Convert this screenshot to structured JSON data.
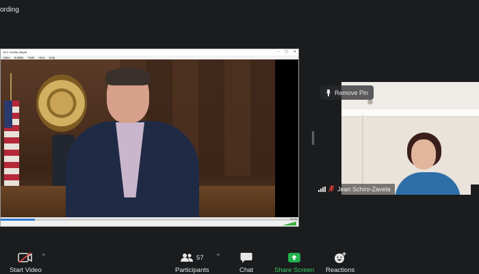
{
  "status": {
    "recording_label": "ording"
  },
  "shared_window": {
    "title": "VLC media player",
    "menu": [
      "Video",
      "Subtitle",
      "Tools",
      "View",
      "Help"
    ],
    "time": "25:26",
    "window_controls": [
      "–",
      "▢",
      "✕"
    ]
  },
  "pinned": {
    "remove_pin_label": "Remove Pin",
    "participant_name": "Jean Schiro-Zavela"
  },
  "toolbar": {
    "start_video": "Start Video",
    "participants": "Participants",
    "participants_count": "57",
    "chat": "Chat",
    "share_screen": "Share Screen",
    "reactions": "Reactions",
    "caret": "^"
  },
  "colors": {
    "background": "#1a1c1e",
    "share_green": "#22b14c",
    "muted_red": "#e0413a"
  },
  "icons": {
    "video": "video-off-icon",
    "participants": "participants-icon",
    "chat": "chat-bubble-icon",
    "share": "share-screen-icon",
    "reactions": "reactions-icon",
    "pin": "pin-icon",
    "mic": "mic-muted-icon",
    "signal": "signal-bars-icon"
  }
}
